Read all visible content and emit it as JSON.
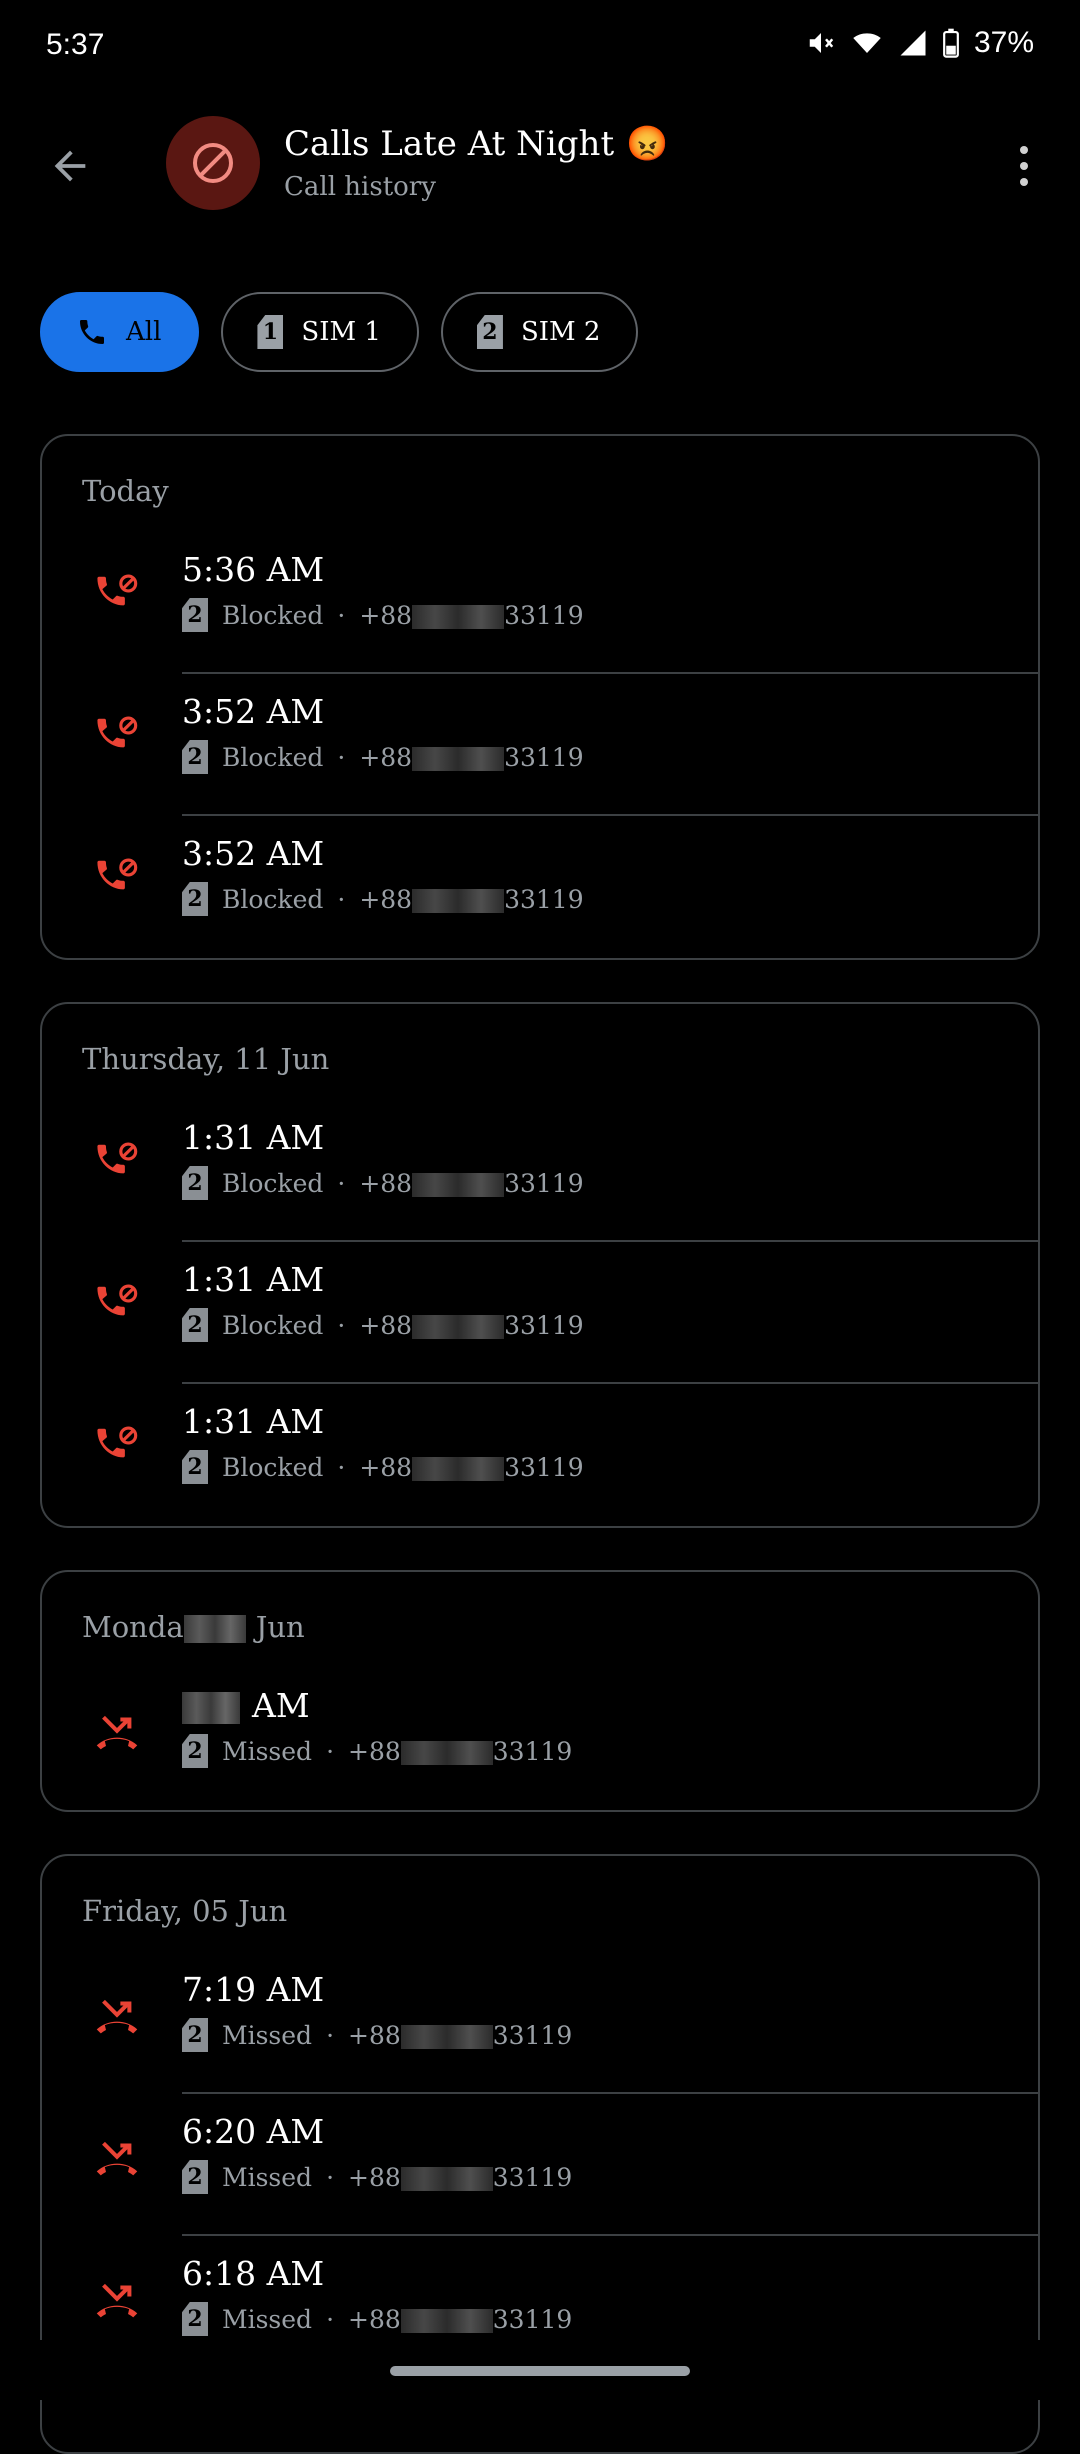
{
  "status": {
    "time": "5:37",
    "battery": "37%"
  },
  "header": {
    "title": "Calls Late At Night",
    "emoji": "😡",
    "subtitle": "Call history"
  },
  "chips": [
    {
      "label": "All",
      "active": true
    },
    {
      "label": "SIM 1",
      "sim": "1",
      "active": false
    },
    {
      "label": "SIM 2",
      "sim": "2",
      "active": false
    }
  ],
  "cards": [
    {
      "head": "Today",
      "calls": [
        {
          "time": "5:36 AM",
          "status": "Blocked",
          "sim": "2",
          "number_prefix": "+88",
          "number_suffix": "33119"
        },
        {
          "time": "3:52 AM",
          "status": "Blocked",
          "sim": "2",
          "number_prefix": "+88",
          "number_suffix": "33119"
        },
        {
          "time": "3:52 AM",
          "status": "Blocked",
          "sim": "2",
          "number_prefix": "+88",
          "number_suffix": "33119"
        }
      ]
    },
    {
      "head": "Thursday, 11 Jun",
      "calls": [
        {
          "time": "1:31 AM",
          "status": "Blocked",
          "sim": "2",
          "number_prefix": "+88",
          "number_suffix": "33119"
        },
        {
          "time": "1:31 AM",
          "status": "Blocked",
          "sim": "2",
          "number_prefix": "+88",
          "number_suffix": "33119"
        },
        {
          "time": "1:31 AM",
          "status": "Blocked",
          "sim": "2",
          "number_prefix": "+88",
          "number_suffix": "33119"
        }
      ]
    },
    {
      "head_prefix": "Monda",
      "head_suffix": "Jun",
      "calls": [
        {
          "time_suffix": "AM",
          "status": "Missed",
          "sim": "2",
          "number_prefix": "+88",
          "number_suffix": "33119"
        }
      ]
    },
    {
      "head": "Friday, 05 Jun",
      "calls": [
        {
          "time": "7:19 AM",
          "status": "Missed",
          "sim": "2",
          "number_prefix": "+88",
          "number_suffix": "33119"
        },
        {
          "time": "6:20 AM",
          "status": "Missed",
          "sim": "2",
          "number_prefix": "+88",
          "number_suffix": "33119"
        },
        {
          "time": "6:18 AM",
          "status": "Missed",
          "sim": "2",
          "number_prefix": "+88",
          "number_suffix": "33119"
        }
      ]
    }
  ],
  "separator": "·",
  "colors": {
    "accent": "#1a73e8",
    "blocked": "#ea4335",
    "missed": "#ea4335",
    "avatar_bg": "#5a1712"
  }
}
